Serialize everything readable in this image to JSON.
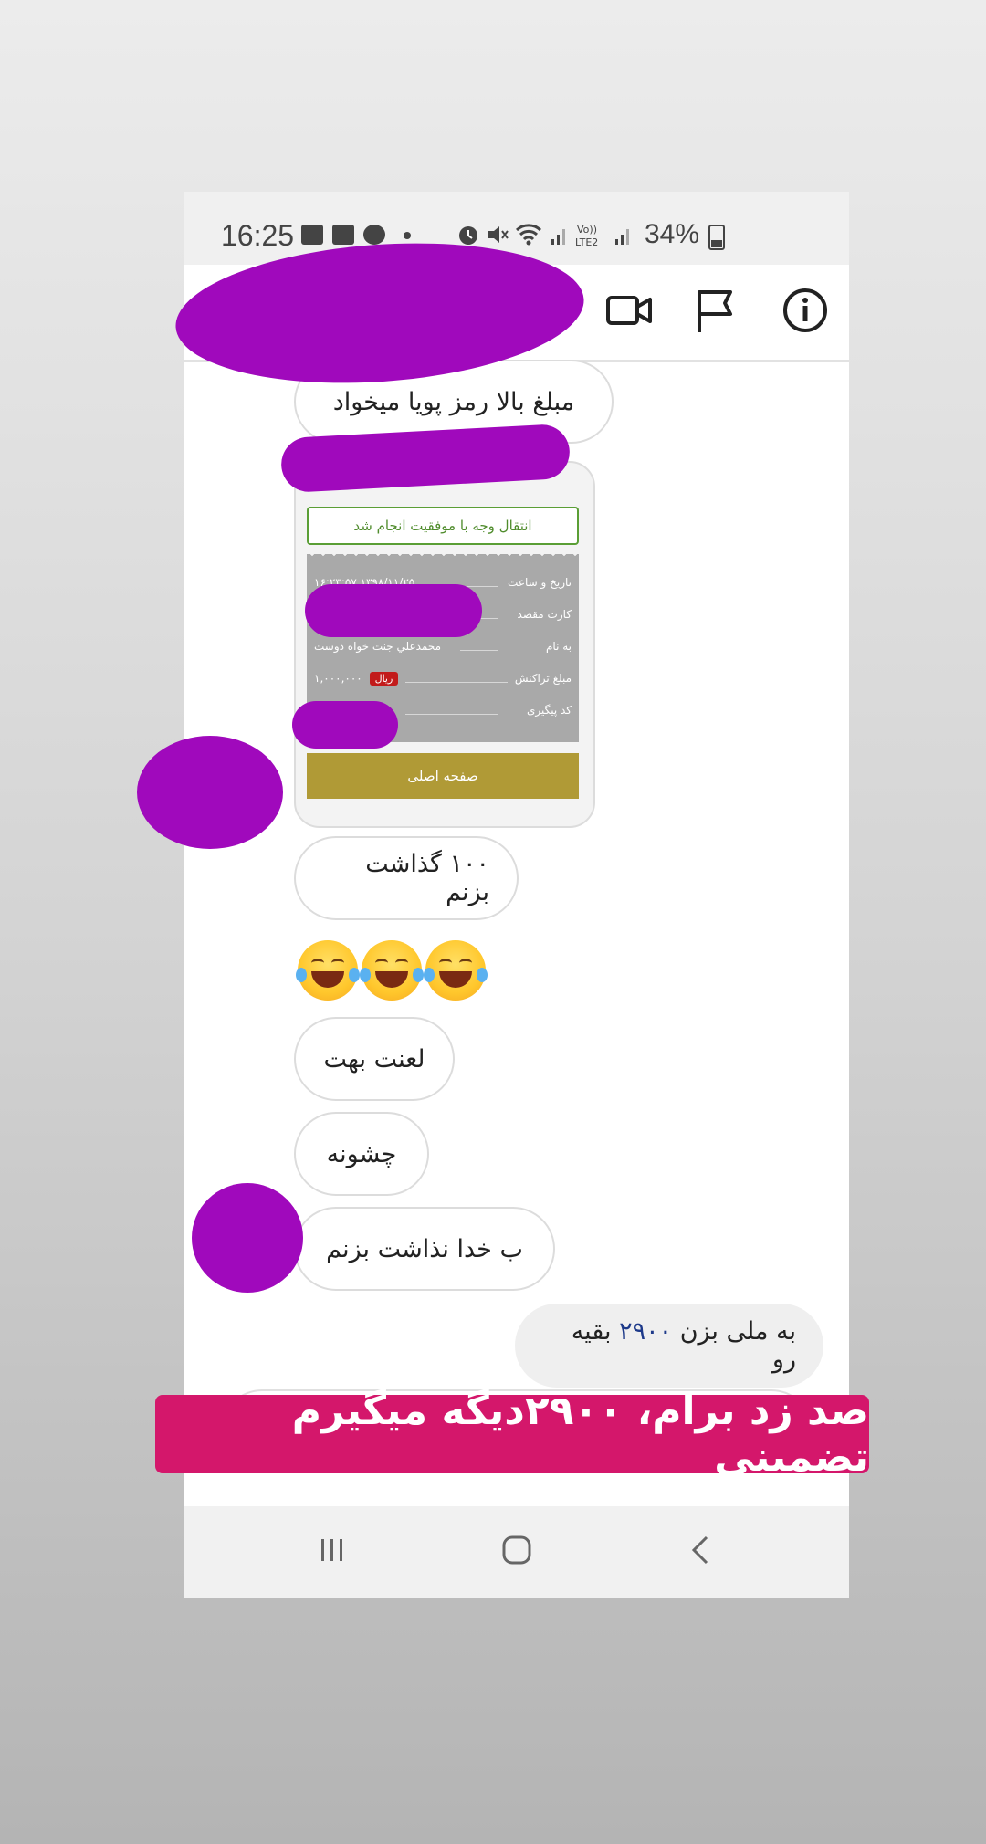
{
  "status_bar": {
    "time": "16:25",
    "battery": "34%",
    "icons": [
      "message-icon",
      "calendar-icon",
      "facebook-icon",
      "dot-icon",
      "alarm-icon",
      "mute-icon",
      "wifi-icon",
      "signal-icon",
      "volte-icon",
      "signal-icon",
      "battery-icon"
    ]
  },
  "header": {
    "icons": [
      "video-call-icon",
      "flag-icon",
      "info-icon"
    ]
  },
  "messages": [
    {
      "direction": "incoming",
      "text": "مبلغ بالا رمز پویا میخواد"
    },
    {
      "direction": "incoming",
      "text": "۱۰۰ گذاشت بزنم"
    },
    {
      "direction": "incoming",
      "text": "😂😂😂"
    },
    {
      "direction": "incoming",
      "text": "لعنت بهت"
    },
    {
      "direction": "incoming",
      "text": "چشونه"
    },
    {
      "direction": "incoming",
      "text": "ب خدا نذاشت بزنم"
    },
    {
      "direction": "outgoing",
      "text_before": "به ملی بزن ",
      "number": "۲۹۰۰",
      "text_after": " بقیه رو"
    }
  ],
  "receipt": {
    "success": "انتقال وجه با موفقیت انجام شد",
    "rows": [
      {
        "label": "تاریخ و ساعت",
        "value": "۱۳۹۸/۱۱/۲۵ ۱۶:۲۳:۵۷"
      },
      {
        "label": "کارت مقصد",
        "value": ""
      },
      {
        "label": "به نام",
        "value": "محمدعلي جنت خواه دوست"
      },
      {
        "label": "مبلغ تراکنش",
        "value": "۱,۰۰۰,۰۰۰",
        "unit": "ریال"
      },
      {
        "label": "کد پیگیری",
        "value": ""
      }
    ],
    "home_button": "صفحه اصلی"
  },
  "banner": "صد زد برام، ۲۹۰۰دیگه میگیرم تضمینی",
  "colors": {
    "redaction": "#a009bc",
    "banner": "#d4176b",
    "success_green": "#5a9e35",
    "home_gold": "#b09a36"
  }
}
